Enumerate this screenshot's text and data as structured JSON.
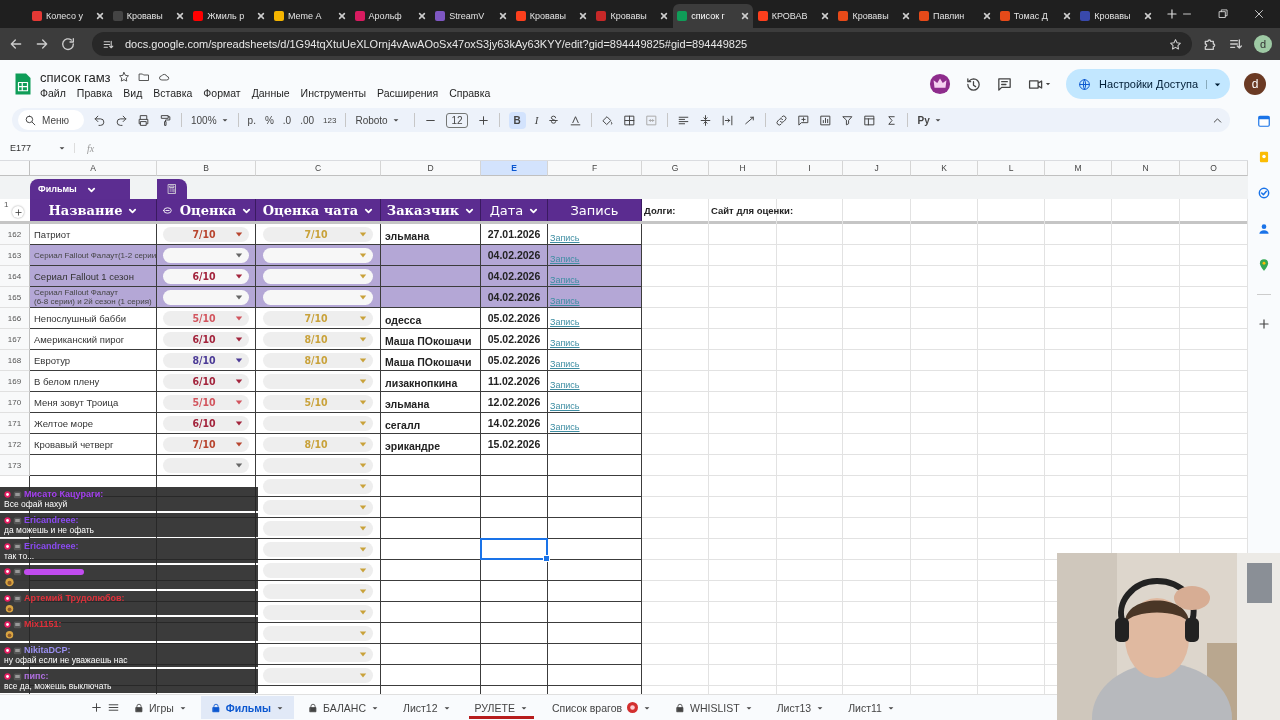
{
  "browser": {
    "tabs": [
      {
        "title": "Колесо у",
        "color": "#e53935",
        "selected": false
      },
      {
        "title": "Кровавы",
        "color": "#444444",
        "selected": false
      },
      {
        "title": "Жмиль р",
        "color": "#ff0000",
        "selected": false
      },
      {
        "title": "Meme А",
        "color": "#f4b400",
        "selected": false
      },
      {
        "title": "Арольф",
        "color": "#d81b60",
        "selected": false
      },
      {
        "title": "StreamV",
        "color": "#7e57c2",
        "selected": false
      },
      {
        "title": "Кровавы",
        "color": "#fc3f1d",
        "selected": false
      },
      {
        "title": "Кровавы",
        "color": "#c62828",
        "selected": false
      },
      {
        "title": "список г",
        "color": "#0f9d58",
        "selected": true
      },
      {
        "title": "КРОВАВ",
        "color": "#fc3f1d",
        "selected": false
      },
      {
        "title": "Кровавы",
        "color": "#e64a19",
        "selected": false
      },
      {
        "title": "Павлин",
        "color": "#e64a19",
        "selected": false
      },
      {
        "title": "Томас Д",
        "color": "#e64a19",
        "selected": false
      },
      {
        "title": "Кровавы",
        "color": "#3949ab",
        "selected": false
      }
    ],
    "url": "docs.google.com/spreadsheets/d/1G94tqXtuUeXLOrnj4vAwAOoSx47oxS3jy63kAy63KYY/edit?gid=894449825#gid=894449825",
    "profile": "d"
  },
  "doc": {
    "title": "список гамз",
    "menu": [
      "Файл",
      "Правка",
      "Вид",
      "Вставка",
      "Формат",
      "Данные",
      "Инструменты",
      "Расширения",
      "Справка"
    ],
    "share_button": "Настройки Доступа",
    "avatar": "d"
  },
  "toolbar": {
    "search": "Меню",
    "zoom": "100%",
    "currency": "р.",
    "percent": "%",
    "dec_minus": ".0",
    "dec_plus": ".00",
    "number_format": "123",
    "font": "Roboto",
    "font_size": "12",
    "bold": "B",
    "bold_on": true,
    "italic": "I",
    "input_tools": "Pу"
  },
  "formula_bar": {
    "cell_ref": "E177",
    "fx": "fx"
  },
  "columns": [
    {
      "letter": "A",
      "selected": false
    },
    {
      "letter": "B",
      "selected": false
    },
    {
      "letter": "C",
      "selected": false
    },
    {
      "letter": "D",
      "selected": false
    },
    {
      "letter": "E",
      "selected": true
    },
    {
      "letter": "F",
      "selected": false
    },
    {
      "letter": "G",
      "selected": false
    },
    {
      "letter": "H",
      "selected": false
    },
    {
      "letter": "I",
      "selected": false
    },
    {
      "letter": "J",
      "selected": false
    },
    {
      "letter": "K",
      "selected": false
    },
    {
      "letter": "L",
      "selected": false
    },
    {
      "letter": "M",
      "selected": false
    },
    {
      "letter": "N",
      "selected": false
    },
    {
      "letter": "O",
      "selected": false
    }
  ],
  "table": {
    "name": "Фильмы",
    "header_row": "1",
    "headers": [
      "Название",
      "Оценка",
      "Оценка чата",
      "Заказчик",
      "Дата",
      "Запись"
    ],
    "extra_cells": [
      "Долги:",
      "Сайт для оценки:"
    ]
  },
  "rows": [
    {
      "number": "162",
      "title": "Патриот",
      "rating": {
        "value": "7/10",
        "color": "#b8452e"
      },
      "chat_rating": {
        "value": "7/10"
      },
      "customer": "эльмана",
      "date": "27.01.2026",
      "link": "Запись",
      "highlighted": false
    },
    {
      "number": "163",
      "title": "Сериал Fallout Фалаут(1-2 серии",
      "rating": {},
      "chat_rating": {},
      "date": "04.02.2026",
      "link": "Запись",
      "highlighted": true
    },
    {
      "number": "164",
      "title": "Сериал Fallout 1 сезон",
      "rating": {
        "value": "6/10",
        "color": "#a3243c"
      },
      "chat_rating": {},
      "date": "04.02.2026",
      "link": "Запись",
      "highlighted": true
    },
    {
      "number": "165",
      "title": "Сериал Fallout Фалаут\n(6-8 серии) и 2й сезон (1 серия)",
      "rating": {},
      "chat_rating": {},
      "date": "04.02.2026",
      "link": "Запись",
      "highlighted": true
    },
    {
      "number": "166",
      "title": "Непослушный бабби",
      "rating": {
        "value": "5/10",
        "color": "#d2555e"
      },
      "chat_rating": {
        "value": "7/10"
      },
      "customer": "одесса",
      "date": "05.02.2026",
      "link": "Запись",
      "highlighted": false
    },
    {
      "number": "167",
      "title": "Американский пирог",
      "rating": {
        "value": "6/10",
        "color": "#a3243c"
      },
      "chat_rating": {
        "value": "8/10"
      },
      "customer": "Маша ПОкошачи",
      "date": "05.02.2026",
      "link": "Запись",
      "highlighted": false
    },
    {
      "number": "168",
      "title": "Евротур",
      "rating": {
        "value": "8/10",
        "color": "#4b3a96"
      },
      "chat_rating": {
        "value": "8/10"
      },
      "customer": "Маша ПОкошачи",
      "date": "05.02.2026",
      "link": "Запись",
      "highlighted": false
    },
    {
      "number": "169",
      "title": "В белом плену",
      "rating": {
        "value": "6/10",
        "color": "#a3243c"
      },
      "chat_rating": {},
      "customer": "лизакнопкина",
      "date": "11.02.2026",
      "link": "Запись",
      "highlighted": false
    },
    {
      "number": "170",
      "title": "Меня зовут Троица",
      "rating": {
        "value": "5/10",
        "color": "#d2555e"
      },
      "chat_rating": {
        "value": "5/10"
      },
      "customer": "эльмана",
      "date": "12.02.2026",
      "link": "Запись",
      "highlighted": false
    },
    {
      "number": "171",
      "title": "Желтое море",
      "rating": {
        "value": "6/10",
        "color": "#a3243c"
      },
      "chat_rating": {},
      "customer": "сегалл",
      "date": "14.02.2026",
      "link": "Запись",
      "highlighted": false
    },
    {
      "number": "172",
      "title": "Кровавый четверг",
      "rating": {
        "value": "7/10",
        "color": "#b8452e"
      },
      "chat_rating": {
        "value": "8/10"
      },
      "customer": "эрикандре",
      "date": "15.02.2026",
      "highlighted": false
    }
  ],
  "empty_rows": [
    {
      "number": "173",
      "selected": false
    },
    {
      "selected": false
    },
    {
      "selected": false
    },
    {
      "selected": false
    },
    {
      "selected": true
    },
    {
      "selected": false
    },
    {
      "selected": false
    },
    {
      "selected": false
    },
    {
      "selected": false
    },
    {
      "selected": false
    },
    {
      "selected": false
    }
  ],
  "sheet_tabs": [
    {
      "label": "Игры",
      "locked": true,
      "badge": false,
      "selected": false
    },
    {
      "label": "Фильмы",
      "locked": true,
      "badge": false,
      "selected": true
    },
    {
      "label": "БАЛАНС",
      "locked": true,
      "badge": false,
      "selected": false
    },
    {
      "label": "Лист12",
      "locked": false,
      "badge": false,
      "selected": false
    },
    {
      "label": "РУЛЕТЕ",
      "locked": false,
      "badge": false,
      "selected": false,
      "color": "#b71c1c"
    },
    {
      "label": "Список врагов",
      "locked": false,
      "badge": true,
      "selected": false
    },
    {
      "label": "WHISLIST",
      "locked": true,
      "badge": false,
      "selected": false
    },
    {
      "label": "Лист13",
      "locked": false,
      "badge": false,
      "selected": false
    },
    {
      "label": "Лист11",
      "locked": false,
      "badge": false,
      "selected": false
    }
  ],
  "chat": [
    {
      "kind": "text",
      "name": "Мисато Кацураги:",
      "color": "#a43ff0",
      "text": "Все офай нахуй"
    },
    {
      "kind": "text",
      "name": "Ericandreee:",
      "color": "#8a4af0",
      "text": "да можешь и не офать"
    },
    {
      "kind": "text",
      "name": "Ericandreee:",
      "color": "#8a4af0",
      "text": "так то..."
    },
    {
      "kind": "emote",
      "color": "#c24cf0"
    },
    {
      "kind": "emote",
      "name": "Артемий Трудолюбов:",
      "color": "#e0303a"
    },
    {
      "kind": "emote",
      "name": "Mix1151:",
      "color": "#e0303a"
    },
    {
      "kind": "text",
      "name": "NikitaDCP:",
      "color": "#9a8ff0",
      "text": "ну офай если не уважаешь нас"
    },
    {
      "kind": "text",
      "name": "пипс:",
      "color": "#b070e0",
      "text": "все да, можешь выключать"
    }
  ]
}
